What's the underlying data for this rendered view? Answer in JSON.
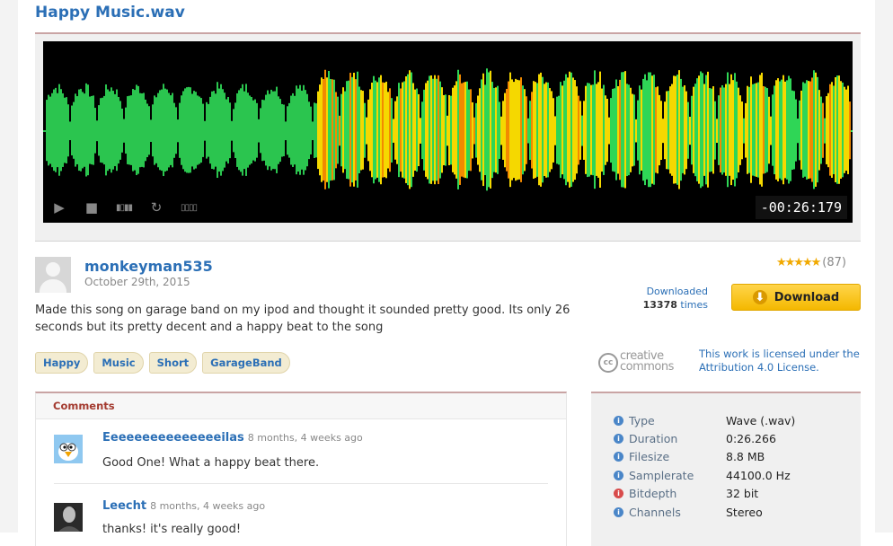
{
  "sound": {
    "title": "Happy Music.wav"
  },
  "player": {
    "time": "-00:26:179",
    "controls": {
      "play_icon": "play-icon",
      "stop_icon": "stop-icon",
      "spectrogram_icon": "spectrogram-icon",
      "loop_icon": "loop-icon",
      "volume_icon": "volume-icon"
    },
    "colors": {
      "wave_green": "#2fd656",
      "wave_yellow": "#f5d800",
      "wave_orange": "#f28a00",
      "background": "#000000"
    }
  },
  "uploader": {
    "name": "monkeyman535",
    "date": "October 29th, 2015",
    "description": "Made this song on garage band on my ipod and thought it sounded pretty good. Its only 26 seconds but its pretty decent and a happy beat to the song"
  },
  "tags": [
    "Happy",
    "Music",
    "Short",
    "GarageBand"
  ],
  "rating": {
    "stars_text": "★★★★★",
    "count": "(87)",
    "value": 4.5
  },
  "downloads": {
    "label": "Downloaded",
    "count": "13378",
    "suffix": "times",
    "button_label": "Download"
  },
  "license": {
    "logo_line1": "creative",
    "logo_line2": "commons",
    "logo_badge": "cc",
    "text": "This work is licensed under the Attribution 4.0 License."
  },
  "comments": {
    "title": "Comments",
    "items": [
      {
        "author": "Eeeeeeeeeeeeeeeilas",
        "when": "8 months, 4 weeks ago",
        "text": "Good One! What a happy beat there."
      },
      {
        "author": "Leecht",
        "when": "8 months, 4 weeks ago",
        "text": "thanks! it's really good!"
      }
    ]
  },
  "info": {
    "rows": [
      {
        "label": "Type",
        "value": "Wave (.wav)"
      },
      {
        "label": "Duration",
        "value": "0:26.266"
      },
      {
        "label": "Filesize",
        "value": "8.8 MB"
      },
      {
        "label": "Samplerate",
        "value": "44100.0 Hz"
      },
      {
        "label": "Bitdepth",
        "value": "32 bit"
      },
      {
        "label": "Channels",
        "value": "Stereo"
      }
    ]
  }
}
